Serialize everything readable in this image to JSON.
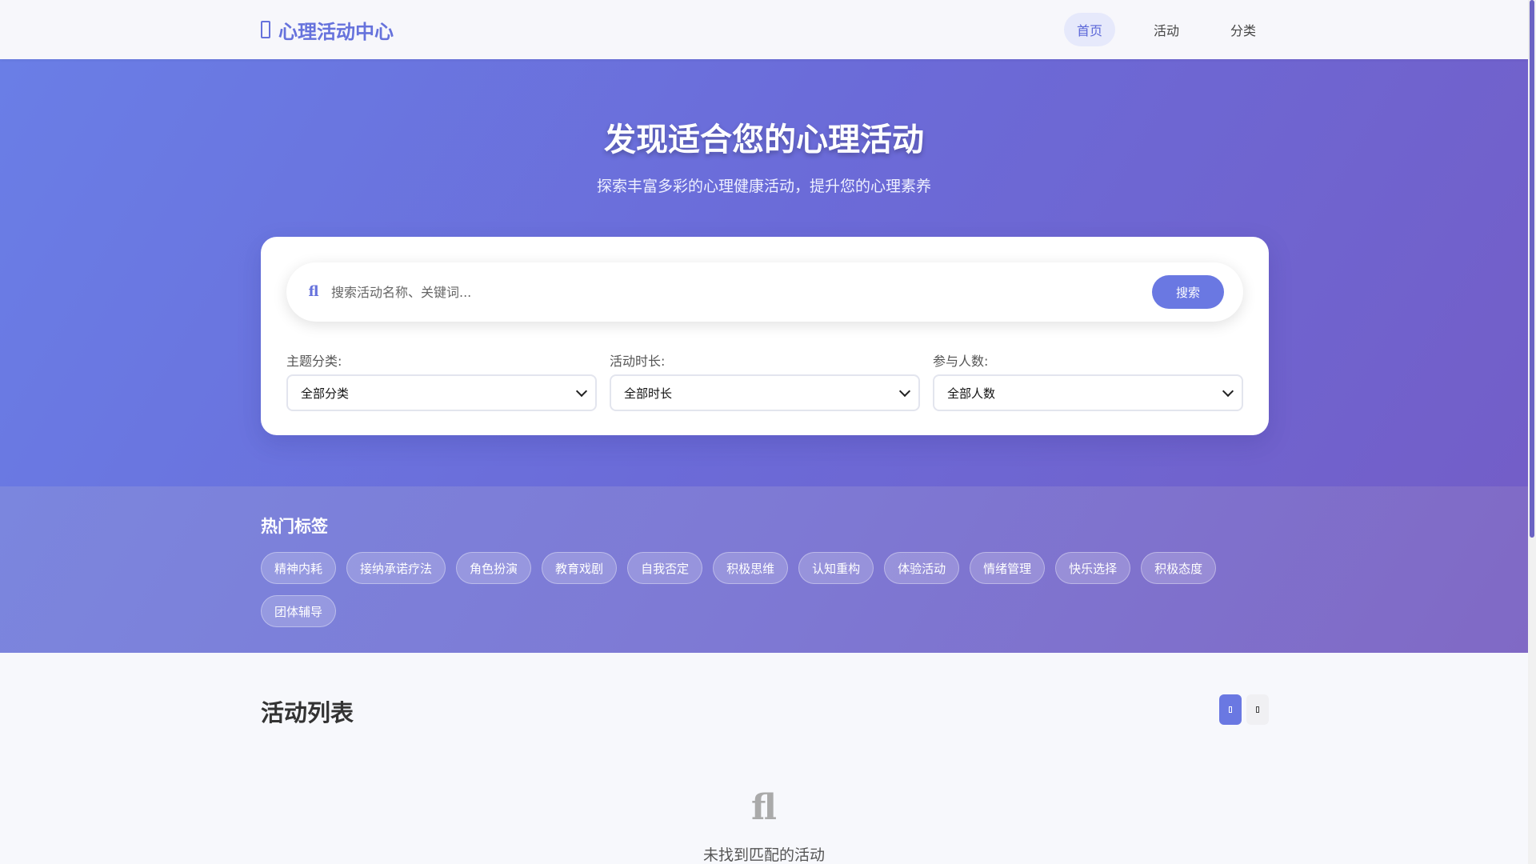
{
  "header": {
    "brand": "心理活动中心",
    "nav": [
      {
        "label": "首页",
        "active": true
      },
      {
        "label": "活动",
        "active": false
      },
      {
        "label": "分类",
        "active": false
      }
    ]
  },
  "hero": {
    "title": "发现适合您的心理活动",
    "subtitle": "探索丰富多彩的心理健康活动，提升您的心理素养"
  },
  "search": {
    "icon_glyph": "ﬂ",
    "placeholder": "搜索活动名称、关键词...",
    "button": "搜索"
  },
  "filters": [
    {
      "label": "主题分类:",
      "selected": "全部分类"
    },
    {
      "label": "活动时长:",
      "selected": "全部时长"
    },
    {
      "label": "参与人数:",
      "selected": "全部人数"
    }
  ],
  "hot_tags": {
    "title": "热门标签",
    "tags": [
      "精神内耗",
      "接纳承诺疗法",
      "角色扮演",
      "教育戏剧",
      "自我否定",
      "积极思维",
      "认知重构",
      "体验活动",
      "情绪管理",
      "快乐选择",
      "积极态度",
      "团体辅导"
    ]
  },
  "activities": {
    "title": "活动列表",
    "empty_icon_glyph": "ﬂ",
    "empty_text": "未找到匹配的活动"
  },
  "colors": {
    "accent": "#6a78e2",
    "brand": "#6672dc",
    "hero_start": "#6a7ee6",
    "hero_end": "#735ec8"
  }
}
